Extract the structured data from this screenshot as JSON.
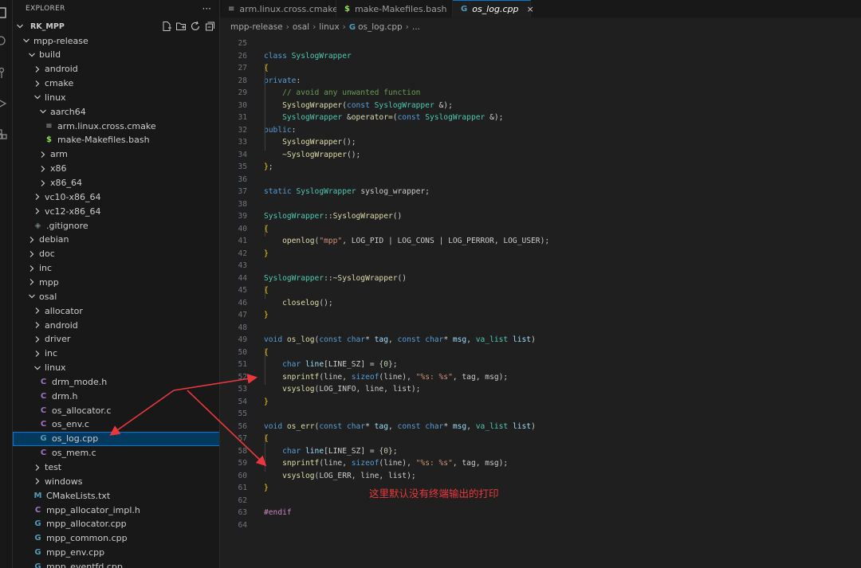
{
  "explorer": {
    "title": "EXPLORER",
    "more": "···",
    "root": "RK_MPP"
  },
  "tree": [
    {
      "label": "mpp-release",
      "type": "folder",
      "open": true,
      "depth": 0
    },
    {
      "label": "build",
      "type": "folder",
      "open": true,
      "depth": 1
    },
    {
      "label": "android",
      "type": "folder",
      "open": false,
      "depth": 2
    },
    {
      "label": "cmake",
      "type": "folder",
      "open": false,
      "depth": 2
    },
    {
      "label": "linux",
      "type": "folder",
      "open": true,
      "depth": 2
    },
    {
      "label": "aarch64",
      "type": "folder",
      "open": true,
      "depth": 3
    },
    {
      "label": "arm.linux.cross.cmake",
      "type": "cmake",
      "icon": "≡",
      "depth": 4
    },
    {
      "label": "make-Makefiles.bash",
      "type": "bash",
      "icon": "$",
      "depth": 4
    },
    {
      "label": "arm",
      "type": "folder",
      "open": false,
      "depth": 3
    },
    {
      "label": "x86",
      "type": "folder",
      "open": false,
      "depth": 3
    },
    {
      "label": "x86_64",
      "type": "folder",
      "open": false,
      "depth": 3
    },
    {
      "label": "vc10-x86_64",
      "type": "folder",
      "open": false,
      "depth": 2
    },
    {
      "label": "vc12-x86_64",
      "type": "folder",
      "open": false,
      "depth": 2
    },
    {
      "label": ".gitignore",
      "type": "git",
      "icon": "◈",
      "depth": 2
    },
    {
      "label": "debian",
      "type": "folder",
      "open": false,
      "depth": 1
    },
    {
      "label": "doc",
      "type": "folder",
      "open": false,
      "depth": 1
    },
    {
      "label": "inc",
      "type": "folder",
      "open": false,
      "depth": 1
    },
    {
      "label": "mpp",
      "type": "folder",
      "open": false,
      "depth": 1
    },
    {
      "label": "osal",
      "type": "folder",
      "open": true,
      "depth": 1
    },
    {
      "label": "allocator",
      "type": "folder",
      "open": false,
      "depth": 2
    },
    {
      "label": "android",
      "type": "folder",
      "open": false,
      "depth": 2
    },
    {
      "label": "driver",
      "type": "folder",
      "open": false,
      "depth": 2
    },
    {
      "label": "inc",
      "type": "folder",
      "open": false,
      "depth": 2
    },
    {
      "label": "linux",
      "type": "folder",
      "open": true,
      "depth": 2
    },
    {
      "label": "drm_mode.h",
      "type": "h",
      "icon": "C",
      "depth": 3
    },
    {
      "label": "drm.h",
      "type": "h",
      "icon": "C",
      "depth": 3
    },
    {
      "label": "os_allocator.c",
      "type": "c",
      "icon": "C",
      "depth": 3
    },
    {
      "label": "os_env.c",
      "type": "c",
      "icon": "C",
      "depth": 3
    },
    {
      "label": "os_log.cpp",
      "type": "cpp",
      "icon": "G",
      "depth": 3,
      "selected": true
    },
    {
      "label": "os_mem.c",
      "type": "c",
      "icon": "C",
      "depth": 3
    },
    {
      "label": "test",
      "type": "folder",
      "open": false,
      "depth": 2
    },
    {
      "label": "windows",
      "type": "folder",
      "open": false,
      "depth": 2
    },
    {
      "label": "CMakeLists.txt",
      "type": "m",
      "icon": "M",
      "depth": 2
    },
    {
      "label": "mpp_allocator_impl.h",
      "type": "h",
      "icon": "C",
      "depth": 2
    },
    {
      "label": "mpp_allocator.cpp",
      "type": "cpp",
      "icon": "G",
      "depth": 2
    },
    {
      "label": "mpp_common.cpp",
      "type": "cpp",
      "icon": "G",
      "depth": 2
    },
    {
      "label": "mpp_env.cpp",
      "type": "cpp",
      "icon": "G",
      "depth": 2
    },
    {
      "label": "mpp_eventfd.cpp",
      "type": "cpp",
      "icon": "G",
      "depth": 2
    }
  ],
  "tabs": [
    {
      "label": "arm.linux.cross.cmake",
      "icon": "≡",
      "active": false
    },
    {
      "label": "make-Makefiles.bash",
      "icon": "$",
      "active": false
    },
    {
      "label": "os_log.cpp",
      "icon": "G",
      "active": true,
      "close": "×"
    }
  ],
  "breadcrumb": [
    "mpp-release",
    "osal",
    "linux",
    "os_log.cpp",
    "..."
  ],
  "code_lines": [
    {
      "n": "25",
      "t": []
    },
    {
      "n": "26",
      "t": [
        [
          "kw",
          "class "
        ],
        [
          "cls",
          "SyslogWrapper"
        ]
      ]
    },
    {
      "n": "27",
      "t": [
        [
          "pun",
          "{"
        ]
      ]
    },
    {
      "n": "28",
      "t": [
        [
          "kw",
          "private"
        ],
        [
          "plain",
          ":"
        ]
      ]
    },
    {
      "n": "29",
      "t": [
        [
          "plain",
          "    "
        ],
        [
          "com",
          "// avoid any unwanted function"
        ]
      ]
    },
    {
      "n": "30",
      "t": [
        [
          "plain",
          "    "
        ],
        [
          "fn",
          "SyslogWrapper"
        ],
        [
          "plain",
          "("
        ],
        [
          "kw",
          "const "
        ],
        [
          "cls",
          "SyslogWrapper "
        ],
        [
          "plain",
          "&);"
        ]
      ]
    },
    {
      "n": "31",
      "t": [
        [
          "plain",
          "    "
        ],
        [
          "cls",
          "SyslogWrapper "
        ],
        [
          "plain",
          "&"
        ],
        [
          "fn",
          "operator="
        ],
        [
          "plain",
          "("
        ],
        [
          "kw",
          "const "
        ],
        [
          "cls",
          "SyslogWrapper "
        ],
        [
          "plain",
          "&);"
        ]
      ]
    },
    {
      "n": "32",
      "t": [
        [
          "kw",
          "public"
        ],
        [
          "plain",
          ":"
        ]
      ]
    },
    {
      "n": "33",
      "t": [
        [
          "plain",
          "    "
        ],
        [
          "fn",
          "SyslogWrapper"
        ],
        [
          "plain",
          "();"
        ]
      ]
    },
    {
      "n": "34",
      "t": [
        [
          "plain",
          "    "
        ],
        [
          "fn",
          "~SyslogWrapper"
        ],
        [
          "plain",
          "();"
        ]
      ]
    },
    {
      "n": "35",
      "t": [
        [
          "pun",
          "}"
        ],
        [
          "plain",
          ";"
        ]
      ]
    },
    {
      "n": "36",
      "t": []
    },
    {
      "n": "37",
      "t": [
        [
          "kw",
          "static "
        ],
        [
          "cls",
          "SyslogWrapper "
        ],
        [
          "plain",
          "syslog_wrapper;"
        ]
      ]
    },
    {
      "n": "38",
      "t": []
    },
    {
      "n": "39",
      "t": [
        [
          "cls",
          "SyslogWrapper"
        ],
        [
          "plain",
          "::"
        ],
        [
          "fn",
          "SyslogWrapper"
        ],
        [
          "plain",
          "()"
        ]
      ]
    },
    {
      "n": "40",
      "t": [
        [
          "pun",
          "{"
        ]
      ]
    },
    {
      "n": "41",
      "t": [
        [
          "plain",
          "    "
        ],
        [
          "fn",
          "openlog"
        ],
        [
          "plain",
          "("
        ],
        [
          "str",
          "\"mpp\""
        ],
        [
          "plain",
          ", LOG_PID | LOG_CONS | LOG_PERROR, LOG_USER);"
        ]
      ]
    },
    {
      "n": "42",
      "t": [
        [
          "pun",
          "}"
        ]
      ]
    },
    {
      "n": "43",
      "t": []
    },
    {
      "n": "44",
      "t": [
        [
          "cls",
          "SyslogWrapper"
        ],
        [
          "plain",
          "::"
        ],
        [
          "fn",
          "~SyslogWrapper"
        ],
        [
          "plain",
          "()"
        ]
      ]
    },
    {
      "n": "45",
      "t": [
        [
          "pun",
          "{"
        ]
      ]
    },
    {
      "n": "46",
      "t": [
        [
          "plain",
          "    "
        ],
        [
          "fn",
          "closelog"
        ],
        [
          "plain",
          "();"
        ]
      ]
    },
    {
      "n": "47",
      "t": [
        [
          "pun",
          "}"
        ]
      ]
    },
    {
      "n": "48",
      "t": []
    },
    {
      "n": "49",
      "t": [
        [
          "kw",
          "void "
        ],
        [
          "fn",
          "os_log"
        ],
        [
          "plain",
          "("
        ],
        [
          "kw",
          "const char"
        ],
        [
          "plain",
          "* "
        ],
        [
          "var",
          "tag"
        ],
        [
          "plain",
          ", "
        ],
        [
          "kw",
          "const char"
        ],
        [
          "plain",
          "* "
        ],
        [
          "var",
          "msg"
        ],
        [
          "plain",
          ", "
        ],
        [
          "cls",
          "va_list "
        ],
        [
          "var",
          "list"
        ],
        [
          "plain",
          ")"
        ]
      ]
    },
    {
      "n": "50",
      "t": [
        [
          "pun",
          "{"
        ]
      ]
    },
    {
      "n": "51",
      "t": [
        [
          "plain",
          "    "
        ],
        [
          "kw",
          "char "
        ],
        [
          "var",
          "line"
        ],
        [
          "plain",
          "[LINE_SZ] = {"
        ],
        [
          "num",
          "0"
        ],
        [
          "plain",
          "};"
        ]
      ]
    },
    {
      "n": "52",
      "t": [
        [
          "plain",
          "    "
        ],
        [
          "fn",
          "snprintf"
        ],
        [
          "plain",
          "(line, "
        ],
        [
          "kw",
          "sizeof"
        ],
        [
          "plain",
          "(line), "
        ],
        [
          "str",
          "\"%s: %s\""
        ],
        [
          "plain",
          ", tag, msg);"
        ]
      ]
    },
    {
      "n": "53",
      "t": [
        [
          "plain",
          "    "
        ],
        [
          "fn",
          "vsyslog"
        ],
        [
          "plain",
          "(LOG_INFO, line, list);"
        ]
      ]
    },
    {
      "n": "54",
      "t": [
        [
          "pun",
          "}"
        ]
      ]
    },
    {
      "n": "55",
      "t": []
    },
    {
      "n": "56",
      "t": [
        [
          "kw",
          "void "
        ],
        [
          "fn",
          "os_err"
        ],
        [
          "plain",
          "("
        ],
        [
          "kw",
          "const char"
        ],
        [
          "plain",
          "* "
        ],
        [
          "var",
          "tag"
        ],
        [
          "plain",
          ", "
        ],
        [
          "kw",
          "const char"
        ],
        [
          "plain",
          "* "
        ],
        [
          "var",
          "msg"
        ],
        [
          "plain",
          ", "
        ],
        [
          "cls",
          "va_list "
        ],
        [
          "var",
          "list"
        ],
        [
          "plain",
          ")"
        ]
      ]
    },
    {
      "n": "57",
      "t": [
        [
          "pun",
          "{"
        ]
      ]
    },
    {
      "n": "58",
      "t": [
        [
          "plain",
          "    "
        ],
        [
          "kw",
          "char "
        ],
        [
          "var",
          "line"
        ],
        [
          "plain",
          "[LINE_SZ] = {"
        ],
        [
          "num",
          "0"
        ],
        [
          "plain",
          "};"
        ]
      ]
    },
    {
      "n": "59",
      "t": [
        [
          "plain",
          "    "
        ],
        [
          "fn",
          "snprintf"
        ],
        [
          "plain",
          "(line, "
        ],
        [
          "kw",
          "sizeof"
        ],
        [
          "plain",
          "(line), "
        ],
        [
          "str",
          "\"%s: %s\""
        ],
        [
          "plain",
          ", tag, msg);"
        ]
      ]
    },
    {
      "n": "60",
      "t": [
        [
          "plain",
          "    "
        ],
        [
          "fn",
          "vsyslog"
        ],
        [
          "plain",
          "(LOG_ERR, line, list);"
        ]
      ]
    },
    {
      "n": "61",
      "t": [
        [
          "pun",
          "}"
        ]
      ]
    },
    {
      "n": "62",
      "t": []
    },
    {
      "n": "63",
      "t": [
        [
          "pre",
          "#endif"
        ]
      ]
    },
    {
      "n": "64",
      "t": []
    }
  ],
  "annotation": "这里默认没有终端输出的打印",
  "colors": {
    "accent": "#0078d4",
    "annotation": "#e8383d",
    "selected_row": "#04395e"
  }
}
